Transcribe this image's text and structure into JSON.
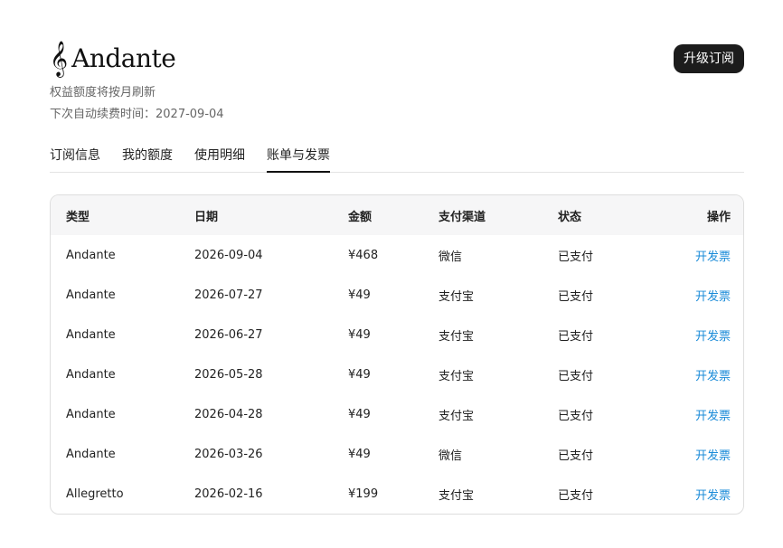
{
  "brand": {
    "name": "Andante",
    "icon": "treble-clef-icon",
    "icon_glyph": "𝄞"
  },
  "upgrade_button": "升级订阅",
  "subtitle": "权益额度将按月刷新",
  "renewal": "下次自动续费时间：2027-09-04",
  "tabs": [
    {
      "label": "订阅信息",
      "active": false
    },
    {
      "label": "我的额度",
      "active": false
    },
    {
      "label": "使用明细",
      "active": false
    },
    {
      "label": "账单与发票",
      "active": true
    }
  ],
  "table": {
    "headers": {
      "type": "类型",
      "date": "日期",
      "amount": "金额",
      "channel": "支付渠道",
      "status": "状态",
      "action": "操作"
    },
    "rows": [
      {
        "type": "Andante",
        "date": "2026-09-04",
        "amount": "¥468",
        "channel": "微信",
        "status": "已支付",
        "action": "开发票"
      },
      {
        "type": "Andante",
        "date": "2026-07-27",
        "amount": "¥49",
        "channel": "支付宝",
        "status": "已支付",
        "action": "开发票"
      },
      {
        "type": "Andante",
        "date": "2026-06-27",
        "amount": "¥49",
        "channel": "支付宝",
        "status": "已支付",
        "action": "开发票"
      },
      {
        "type": "Andante",
        "date": "2026-05-28",
        "amount": "¥49",
        "channel": "支付宝",
        "status": "已支付",
        "action": "开发票"
      },
      {
        "type": "Andante",
        "date": "2026-04-28",
        "amount": "¥49",
        "channel": "支付宝",
        "status": "已支付",
        "action": "开发票"
      },
      {
        "type": "Andante",
        "date": "2026-03-26",
        "amount": "¥49",
        "channel": "微信",
        "status": "已支付",
        "action": "开发票"
      },
      {
        "type": "Allegretto",
        "date": "2026-02-16",
        "amount": "¥199",
        "channel": "支付宝",
        "status": "已支付",
        "action": "开发票"
      }
    ]
  },
  "colors": {
    "accent_link": "#1a8bd8",
    "button_bg": "#1c1c1c",
    "header_bg": "#f6f6f7"
  }
}
